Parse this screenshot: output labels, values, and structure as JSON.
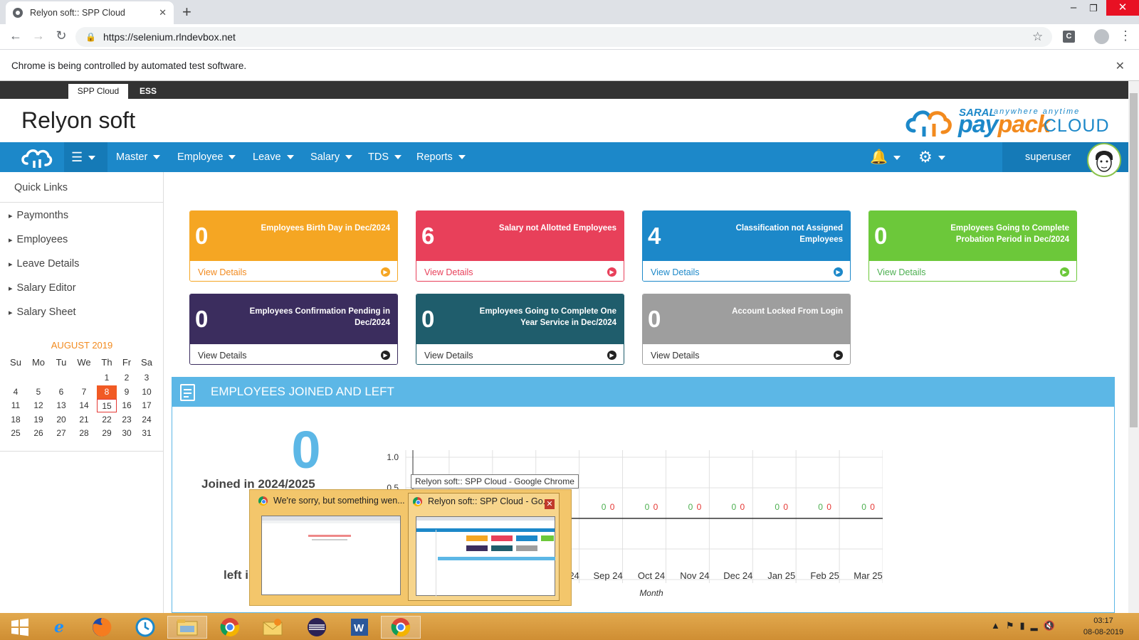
{
  "browser": {
    "tab_title": "Relyon soft:: SPP Cloud",
    "url": "https://selenium.rlndevbox.net",
    "infobar": "Chrome is being controlled by automated test software."
  },
  "app": {
    "tabs": [
      "SPP Cloud",
      "ESS"
    ],
    "brand": "Relyon soft",
    "logo": {
      "saral": "SARAL",
      "tagline": "anywhere anytime",
      "pay": "pay",
      "pack": "pack",
      "cloud": "CLOUD"
    },
    "nav": [
      "Master",
      "Employee",
      "Leave",
      "Salary",
      "TDS",
      "Reports"
    ],
    "user": "superuser"
  },
  "sidebar": {
    "title": "Quick Links",
    "links": [
      "Paymonths",
      "Employees",
      "Leave Details",
      "Salary Editor",
      "Salary Sheet"
    ],
    "calendar": {
      "month": "AUGUST 2019",
      "days": [
        "Su",
        "Mo",
        "Tu",
        "We",
        "Th",
        "Fr",
        "Sa"
      ],
      "weeks": [
        [
          "",
          "",
          "",
          "",
          "1",
          "2",
          "3"
        ],
        [
          "4",
          "5",
          "6",
          "7",
          "8",
          "9",
          "10"
        ],
        [
          "11",
          "12",
          "13",
          "14",
          "15",
          "16",
          "17"
        ],
        [
          "18",
          "19",
          "20",
          "21",
          "22",
          "23",
          "24"
        ],
        [
          "25",
          "26",
          "27",
          "28",
          "29",
          "30",
          "31"
        ]
      ],
      "today": "8",
      "selected": "15"
    }
  },
  "cards": [
    {
      "num": "0",
      "title": "Employees Birth Day in Dec/2024",
      "link": "View Details",
      "color": "#f5a623",
      "link_color": "#f28a1e"
    },
    {
      "num": "6",
      "title": "Salary not Allotted Employees",
      "link": "View Details",
      "color": "#e8405a",
      "link_color": "#e8405a"
    },
    {
      "num": "4",
      "title": "Classification not Assigned Employees",
      "link": "View Details",
      "color": "#1c88c9",
      "link_color": "#1c88c9"
    },
    {
      "num": "0",
      "title": "Employees Going to Complete Probation Period in Dec/2024",
      "link": "View Details",
      "color": "#6cc83a",
      "link_color": "#4caf50"
    },
    {
      "num": "0",
      "title": "Employees Confirmation Pending in Dec/2024",
      "link": "View Details",
      "color": "#3b2d5e",
      "link_color": "#333"
    },
    {
      "num": "0",
      "title": "Employees Going to Complete One Year Service in Dec/2024",
      "link": "View Details",
      "color": "#1f5d6c",
      "link_color": "#333"
    },
    {
      "num": "0",
      "title": "Account Locked From Login",
      "link": "View Details",
      "color": "#9e9e9e",
      "link_color": "#333"
    }
  ],
  "panel": {
    "title": "EMPLOYEES JOINED AND LEFT",
    "big_number": "0",
    "joined_label": "Joined in 2024/2025",
    "left_label": "left i"
  },
  "chart_data": {
    "type": "bar",
    "categories": [
      "Aug 24",
      "Sep 24",
      "Oct 24",
      "Nov 24",
      "Dec 24",
      "Jan 25",
      "Feb 25",
      "Mar 25"
    ],
    "series": [
      {
        "values": [
          0,
          0,
          0,
          0,
          0,
          0,
          0,
          0
        ],
        "color": "#4caf50"
      },
      {
        "values": [
          0,
          0,
          0,
          0,
          0,
          0,
          0,
          0
        ],
        "color": "#e53935"
      }
    ],
    "y_ticks": [
      "1.0",
      "0.5"
    ],
    "xlabel": "Month",
    "ylim": [
      -1,
      1
    ]
  },
  "taskbar_preview": {
    "window1": "We're sorry, but something wen...",
    "window2": "Relyon soft:: SPP Cloud - Go...",
    "tooltip": "Relyon soft:: SPP Cloud - Google Chrome"
  },
  "system": {
    "time": "03:17",
    "date": "08-08-2019"
  }
}
